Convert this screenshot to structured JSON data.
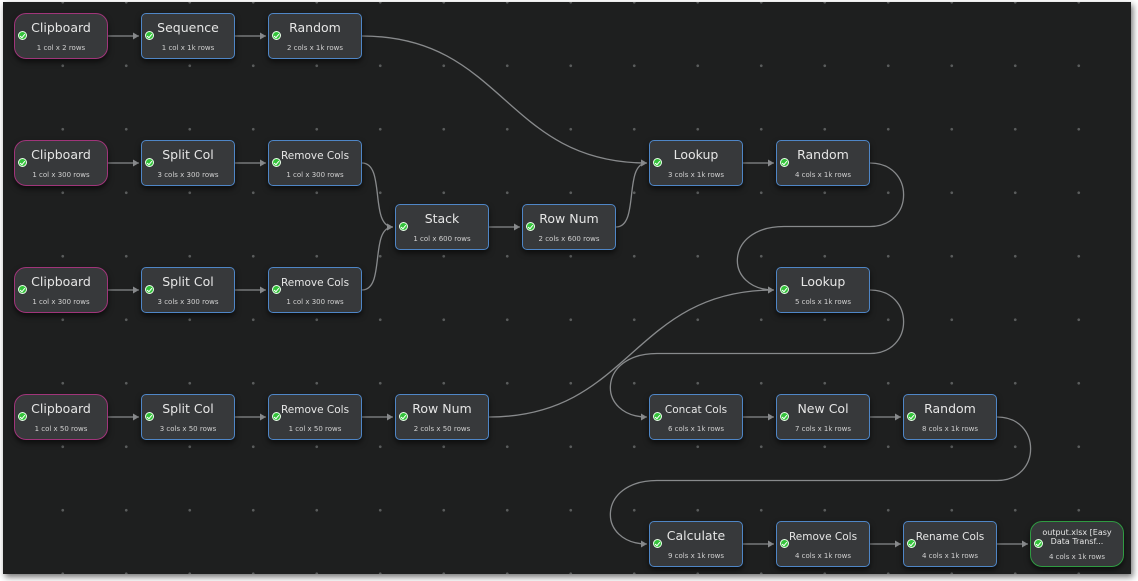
{
  "colors": {
    "background": "#1e1f1f",
    "grid_dot": "#5a5c5c",
    "node_fill": "#37393b",
    "node_border": "#4f86c6",
    "input_border": "#a0357a",
    "output_border": "#2f9b42",
    "edge": "#888a8c",
    "check": "#33c33a"
  },
  "nodes": [
    {
      "id": "n1",
      "title": "Clipboard",
      "sub": "1 col x 2 rows",
      "kind": "input",
      "icon": "check-icon"
    },
    {
      "id": "n2",
      "title": "Sequence",
      "sub": "1 col x 1k rows",
      "kind": "transform",
      "icon": "check-icon"
    },
    {
      "id": "n3",
      "title": "Random",
      "sub": "2 cols x 1k rows",
      "kind": "transform",
      "icon": "check-icon"
    },
    {
      "id": "n4",
      "title": "Clipboard",
      "sub": "1 col x 300 rows",
      "kind": "input",
      "icon": "check-icon"
    },
    {
      "id": "n5",
      "title": "Split Col",
      "sub": "3 cols x 300 rows",
      "kind": "transform",
      "icon": "check-icon"
    },
    {
      "id": "n6",
      "title": "Remove Cols",
      "sub": "1 col x 300 rows",
      "kind": "transform",
      "icon": "check-icon"
    },
    {
      "id": "n7",
      "title": "Clipboard",
      "sub": "1 col x 300 rows",
      "kind": "input",
      "icon": "check-icon"
    },
    {
      "id": "n8",
      "title": "Split Col",
      "sub": "3 cols x 300 rows",
      "kind": "transform",
      "icon": "check-icon"
    },
    {
      "id": "n9",
      "title": "Remove Cols",
      "sub": "1 col x 300 rows",
      "kind": "transform",
      "icon": "check-icon"
    },
    {
      "id": "n10",
      "title": "Stack",
      "sub": "1 col x 600 rows",
      "kind": "transform",
      "icon": "check-icon"
    },
    {
      "id": "n11",
      "title": "Row Num",
      "sub": "2 cols x 600 rows",
      "kind": "transform",
      "icon": "check-icon"
    },
    {
      "id": "n12",
      "title": "Clipboard",
      "sub": "1 col x 50 rows",
      "kind": "input",
      "icon": "check-icon"
    },
    {
      "id": "n13",
      "title": "Split Col",
      "sub": "3 cols x 50 rows",
      "kind": "transform",
      "icon": "check-icon"
    },
    {
      "id": "n14",
      "title": "Remove Cols",
      "sub": "1 col x 50 rows",
      "kind": "transform",
      "icon": "check-icon"
    },
    {
      "id": "n15",
      "title": "Row Num",
      "sub": "2 cols x 50 rows",
      "kind": "transform",
      "icon": "check-icon"
    },
    {
      "id": "n16",
      "title": "Lookup",
      "sub": "3 cols x 1k rows",
      "kind": "transform",
      "icon": "check-icon"
    },
    {
      "id": "n17",
      "title": "Random",
      "sub": "4 cols x 1k rows",
      "kind": "transform",
      "icon": "check-icon"
    },
    {
      "id": "n18",
      "title": "Lookup",
      "sub": "5 cols x 1k rows",
      "kind": "transform",
      "icon": "check-icon"
    },
    {
      "id": "n19",
      "title": "Concat Cols",
      "sub": "6 cols x 1k rows",
      "kind": "transform",
      "icon": "check-icon"
    },
    {
      "id": "n20",
      "title": "New Col",
      "sub": "7 cols x 1k rows",
      "kind": "transform",
      "icon": "check-icon"
    },
    {
      "id": "n21",
      "title": "Random",
      "sub": "8 cols x 1k rows",
      "kind": "transform",
      "icon": "check-icon"
    },
    {
      "id": "n22",
      "title": "Calculate",
      "sub": "9 cols x 1k rows",
      "kind": "transform",
      "icon": "check-icon"
    },
    {
      "id": "n23",
      "title": "Remove Cols",
      "sub": "4 cols x 1k rows",
      "kind": "transform",
      "icon": "check-icon"
    },
    {
      "id": "n24",
      "title": "Rename Cols",
      "sub": "4 cols x 1k rows",
      "kind": "transform",
      "icon": "check-icon"
    },
    {
      "id": "n25",
      "title": "output.xlsx [Easy Data Transf...",
      "sub": "4 cols x 1k rows",
      "kind": "output",
      "icon": "check-icon"
    }
  ],
  "edges": [
    [
      "n1",
      "n2"
    ],
    [
      "n2",
      "n3"
    ],
    [
      "n3",
      "n16"
    ],
    [
      "n4",
      "n5"
    ],
    [
      "n5",
      "n6"
    ],
    [
      "n6",
      "n10"
    ],
    [
      "n7",
      "n8"
    ],
    [
      "n8",
      "n9"
    ],
    [
      "n9",
      "n10"
    ],
    [
      "n10",
      "n11"
    ],
    [
      "n11",
      "n16"
    ],
    [
      "n12",
      "n13"
    ],
    [
      "n13",
      "n14"
    ],
    [
      "n14",
      "n15"
    ],
    [
      "n15",
      "n18"
    ],
    [
      "n16",
      "n17"
    ],
    [
      "n17",
      "n18"
    ],
    [
      "n18",
      "n19"
    ],
    [
      "n19",
      "n20"
    ],
    [
      "n20",
      "n21"
    ],
    [
      "n21",
      "n22"
    ],
    [
      "n22",
      "n23"
    ],
    [
      "n23",
      "n24"
    ],
    [
      "n24",
      "n25"
    ]
  ]
}
